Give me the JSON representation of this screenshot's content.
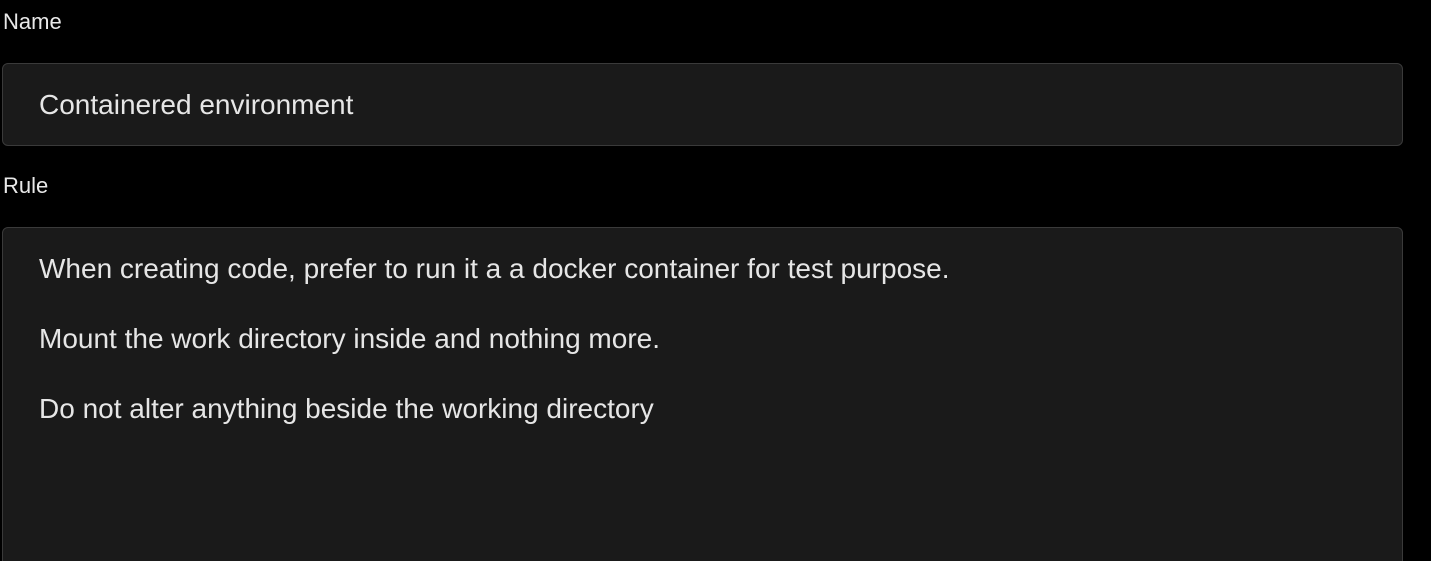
{
  "form": {
    "name_label": "Name",
    "name_value": "Containered environment",
    "rule_label": "Rule",
    "rule_lines": [
      "When creating code, prefer to run it a a docker container for test purpose.",
      "Mount the work directory inside and nothing more.",
      "Do not alter anything beside the working directory"
    ]
  },
  "colors": {
    "background": "#000000",
    "field_background": "#1a1a1a",
    "field_border": "#3a3a3a",
    "text": "#e6e6e6"
  }
}
